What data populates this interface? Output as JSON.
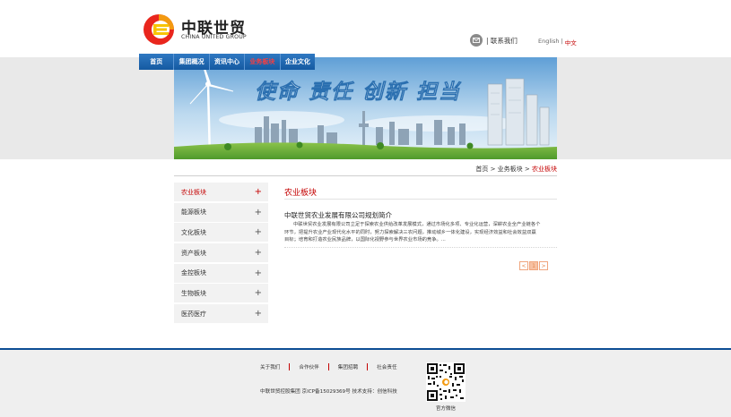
{
  "header": {
    "logo_cn": "中联世贸",
    "logo_en": "CHINA UNITED GROUP",
    "contact_label": "| 联系我们",
    "lang_en": "English",
    "lang_sep": "|",
    "lang_cn": "中文"
  },
  "nav": {
    "items": [
      "首页",
      "集团概况",
      "资讯中心",
      "业务板块",
      "企业文化"
    ],
    "active_index": 3
  },
  "banner": {
    "slogan": "使命 责任 创新 担当"
  },
  "breadcrumb": {
    "home": "首页",
    "sep1": " > ",
    "level2": "业务板块",
    "sep2": " > ",
    "current": "农业板块"
  },
  "sidebar": {
    "items": [
      "农业板块",
      "能源板块",
      "文化板块",
      "资产板块",
      "金控板块",
      "生物板块",
      "医药医疗"
    ],
    "active_index": 0,
    "expand_glyph": "+"
  },
  "main": {
    "section_title": "农业板块",
    "article_title": "中联世贸农业发展有限公司规划简介",
    "article_body": "中联世贸农业发展有限公司立足于探索农业供给改革发展模式，通过市场化多项、专业化运营，深耕农业全产业链各个环节，把提升农业产业现代化水平的同时，努力探索解决三农问题，推动城乡一体化建设，实现经济效益和社会效益双赢目标；培育和打造农业民族品牌，以国际化视野参与世界农业市场的竞争。..."
  },
  "pager": {
    "prev": "<",
    "current": "1",
    "next": ">"
  },
  "footer": {
    "links": [
      "关于我们",
      "合作伙伴",
      "集团招聘",
      "社会责任"
    ],
    "copyright": "中联世贸控股集团   京ICP备15029369号  技术支持：创信科技",
    "qr_label": "官方微信"
  },
  "colors": {
    "accent_red": "#c40000",
    "nav_blue": "#155aa1",
    "footer_border": "#0d4d94"
  }
}
